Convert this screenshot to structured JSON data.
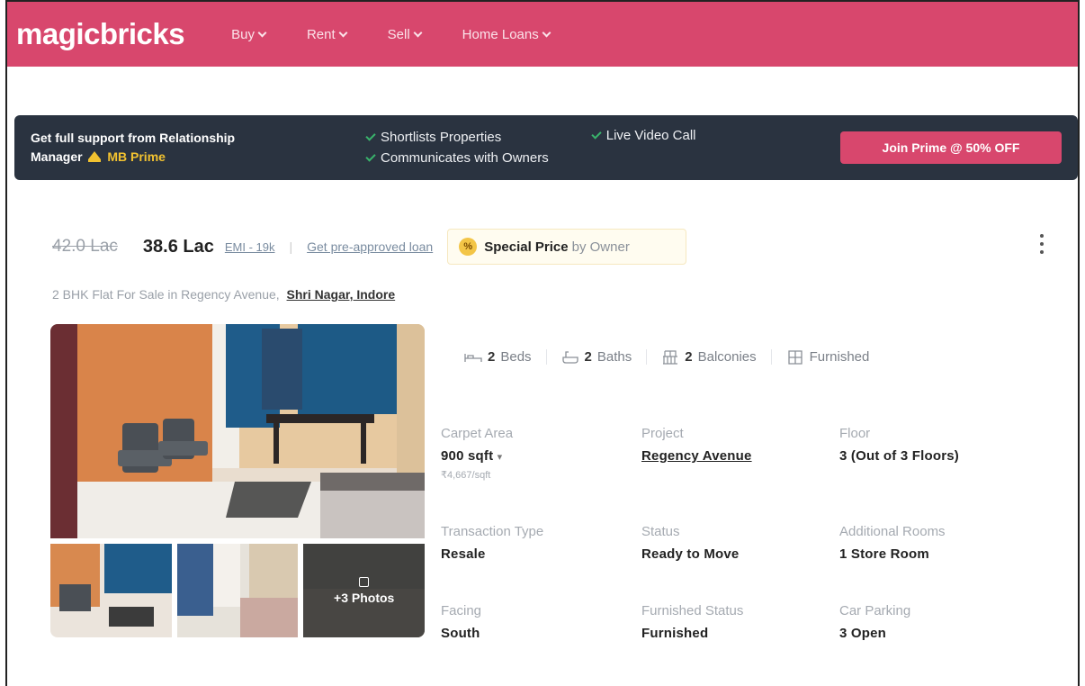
{
  "header": {
    "logo": "magicbricks",
    "nav": [
      {
        "label": "Buy"
      },
      {
        "label": "Rent"
      },
      {
        "label": "Sell"
      },
      {
        "label": "Home Loans"
      }
    ]
  },
  "prime_banner": {
    "message_line1": "Get full support from Relationship",
    "message_line2": "Manager",
    "prime_label": "MB Prime",
    "features": [
      "Shortlists Properties",
      "Communicates with Owners",
      "Live Video Call"
    ],
    "cta": "Join Prime @ 50% OFF"
  },
  "listing": {
    "old_price": "42.0 Lac",
    "price": "38.6 Lac",
    "emi": "EMI - 19k",
    "separator": "|",
    "loan_link": "Get pre-approved loan",
    "special_badge_symbol": "%",
    "special_price": "Special Price",
    "special_by": "by Owner",
    "title": "2 BHK Flat For Sale in Regency Avenue,",
    "location": "Shri Nagar, Indore",
    "photos_more": "+3 Photos",
    "amenities": [
      {
        "count": "2",
        "label": "Beds"
      },
      {
        "count": "2",
        "label": "Baths"
      },
      {
        "count": "2",
        "label": "Balconies"
      },
      {
        "count": "",
        "label": "Furnished"
      }
    ],
    "specs": {
      "carpet_area": {
        "label": "Carpet Area",
        "value": "900 sqft",
        "sub": "₹4,667/sqft"
      },
      "project": {
        "label": "Project",
        "value": "Regency Avenue"
      },
      "floor": {
        "label": "Floor",
        "value": "3 (Out of 3 Floors)"
      },
      "transaction_type": {
        "label": "Transaction Type",
        "value": "Resale"
      },
      "status": {
        "label": "Status",
        "value": "Ready to Move"
      },
      "additional_rooms": {
        "label": "Additional Rooms",
        "value": "1 Store Room"
      },
      "facing": {
        "label": "Facing",
        "value": "South"
      },
      "furnished_status": {
        "label": "Furnished Status",
        "value": "Furnished"
      },
      "car_parking": {
        "label": "Car Parking",
        "value": "3 Open"
      }
    }
  },
  "colors": {
    "brand": "#d8476d",
    "banner_bg": "#2a3340",
    "tick": "#39b36b",
    "gold": "#f2c230"
  }
}
